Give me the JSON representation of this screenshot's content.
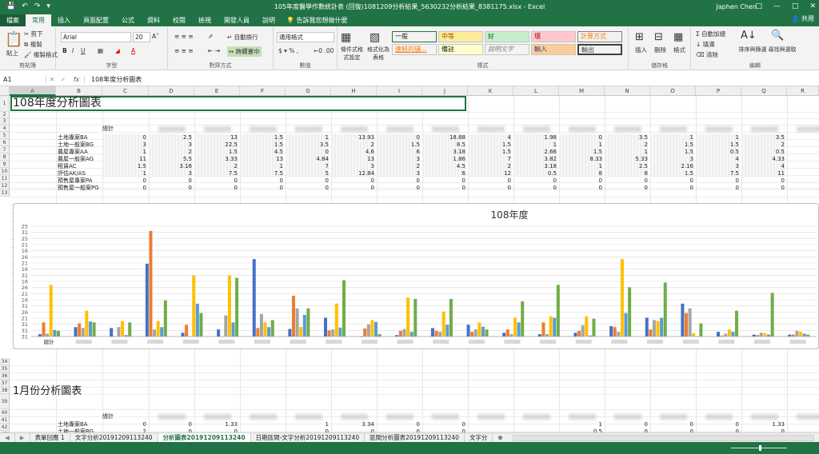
{
  "window": {
    "title": "105年度醫學作數統計表 (回復)1081209分析結果_5630232分析結果_8381175.xlsx  -  Excel",
    "user": "Japhen Chen"
  },
  "ribbon_tabs": [
    "檔案",
    "常用",
    "插入",
    "頁面配置",
    "公式",
    "資料",
    "校閱",
    "檢視",
    "開發人員",
    "說明"
  ],
  "tell_me": "告訴我您想做什麼",
  "share": "共用",
  "clipboard": {
    "paste": "貼上",
    "cut": "剪下",
    "copy": "複製",
    "format_painter": "複製格式",
    "label": "剪貼簿"
  },
  "font": {
    "name": "Arial",
    "size": "20",
    "label": "字型"
  },
  "alignment": {
    "wrap": "自動換行",
    "merge": "跨欄置中",
    "label": "對齊方式"
  },
  "number": {
    "format": "通用格式",
    "label": "數值"
  },
  "styles": {
    "conditional": "條件式格式設定",
    "as_table": "格式化為表格",
    "items": [
      {
        "label": "一般",
        "bg": "#ffffff",
        "fg": "#000000"
      },
      {
        "label": "中等",
        "bg": "#ffeb9c",
        "fg": "#9c5700"
      },
      {
        "label": "好",
        "bg": "#c6efce",
        "fg": "#006100"
      },
      {
        "label": "壞",
        "bg": "#ffc7ce",
        "fg": "#9c0006"
      },
      {
        "label": "計算方式",
        "bg": "#f2f2f2",
        "fg": "#fa7d00"
      },
      {
        "label": "連結的儲...",
        "bg": "#ffffff",
        "fg": "#fa7d00"
      },
      {
        "label": "備註",
        "bg": "#ffffcc",
        "fg": "#000000"
      },
      {
        "label": "說明文字",
        "bg": "#ffffff",
        "fg": "#7f7f7f"
      },
      {
        "label": "輸入",
        "bg": "#ffcc99",
        "fg": "#3f3f76"
      },
      {
        "label": "輸出",
        "bg": "#f2f2f2",
        "fg": "#3f3f3f"
      }
    ],
    "label": "樣式"
  },
  "cells_group": {
    "insert": "插入",
    "delete": "刪除",
    "format": "格式",
    "label": "儲存格"
  },
  "editing": {
    "autosum": "自動加總",
    "fill": "填滿",
    "clear": "清除",
    "sort": "排序與篩選",
    "find": "尋找與選取",
    "label": "編輯"
  },
  "formula_bar": {
    "name_box": "A1",
    "fx": "fx",
    "content": "108年度分析圖表"
  },
  "columns": [
    "A",
    "B",
    "C",
    "D",
    "E",
    "F",
    "G",
    "H",
    "I",
    "J",
    "K",
    "L",
    "M",
    "N",
    "O",
    "P",
    "Q",
    "R"
  ],
  "rows_top": [
    "1",
    "2",
    "3",
    "4",
    "5",
    "6",
    "7",
    "8",
    "9",
    "10",
    "11",
    "12",
    "13"
  ],
  "rows_mid": [
    "34",
    "35",
    "36",
    "37",
    "38",
    "39",
    "40",
    "41",
    "42",
    "43",
    "44"
  ],
  "sheet_title": "108年度分析圖表",
  "header_row_label": "總計",
  "row_labels": [
    "土地專案BA",
    "土地一般案BG",
    "農屋專案AA",
    "農屋一般案AG",
    "租賃AC",
    "評估AK/AS",
    "預售屋專案PA",
    "預售屋一般案PG"
  ],
  "table": [
    [
      "0",
      "2.5",
      "13",
      "1.5",
      "1",
      "13.93",
      "0",
      "18.88",
      "4",
      "1.98",
      "0",
      "3.5",
      "1",
      "1",
      "3.5"
    ],
    [
      "3",
      "3",
      "22.5",
      "1.5",
      "3.5",
      "2",
      "1.5",
      "8.5",
      "1.5",
      "1",
      "1",
      "2",
      "1.5",
      "1.5",
      "2"
    ],
    [
      "1",
      "2",
      "1.5",
      "4.5",
      "0",
      "4.6",
      "6",
      "3.18",
      "1.5",
      "2.66",
      "1.5",
      "1",
      "1.5",
      "0.5",
      "0.5"
    ],
    [
      "11",
      "5.5",
      "3.33",
      "13",
      "4.84",
      "13",
      "3",
      "1.86",
      "7",
      "3.82",
      "8.33",
      "5.33",
      "3",
      "4",
      "4.33"
    ],
    [
      "1.5",
      "3.16",
      "2",
      "1",
      "7",
      "3",
      "2",
      "4.5",
      "2",
      "3.18",
      "1",
      "2.5",
      "2.16",
      "3",
      "4"
    ],
    [
      "1",
      "3",
      "7.5",
      "7.5",
      "5",
      "12.84",
      "3",
      "6",
      "12",
      "0.5",
      "8",
      "8",
      "1.5",
      "7.5",
      "11"
    ],
    [
      "0",
      "0",
      "0",
      "0",
      "0",
      "0",
      "0",
      "0",
      "0",
      "0",
      "0",
      "0",
      "0",
      "0",
      "0"
    ],
    [
      "0",
      "0",
      "0",
      "0",
      "0",
      "0",
      "0",
      "0",
      "0",
      "0",
      "0",
      "0",
      "0",
      "0",
      "0"
    ]
  ],
  "section2_title": "1月份分析圖表",
  "section2_rows": [
    {
      "label": "土地專案BA",
      "values": [
        "0",
        "0",
        "1.33",
        "",
        "1",
        "3.34",
        "0",
        "0",
        "",
        "",
        "1",
        "0",
        "0",
        "0",
        "1.33"
      ]
    },
    {
      "label": "土地一般案BG",
      "values": [
        "2",
        "0",
        "0",
        "",
        "0",
        "0",
        "0",
        "0",
        "",
        "",
        "0.5",
        "0",
        "0",
        "0",
        "0"
      ]
    }
  ],
  "chart_data": {
    "type": "bar",
    "title": "108年度",
    "yticks": [
      "31",
      "31",
      "31",
      "21",
      "26",
      "31",
      "16",
      "21",
      "26",
      "16",
      "31",
      "16",
      "21",
      "26",
      "16",
      "21",
      "25",
      "31",
      "25"
    ],
    "x_first_label": "總計",
    "colors": [
      "#4472c4",
      "#ed7d31",
      "#a5a5a5",
      "#ffc000",
      "#5b9bd5",
      "#70ad47"
    ],
    "groups": 22,
    "series": [
      {
        "values": [
          0.5,
          2,
          1.8,
          15.5,
          0.8,
          1.5,
          16.5,
          1.6,
          4,
          0,
          0.3,
          1.8,
          2.5,
          0.8,
          0.5,
          0.8,
          2.2,
          4,
          7,
          1,
          0.4,
          0.4
        ]
      },
      {
        "values": [
          3,
          2.8,
          0,
          22.5,
          2.5,
          0,
          1.8,
          8.7,
          1.3,
          1.7,
          1.2,
          1.2,
          1,
          1.5,
          3,
          1.2,
          2,
          1.5,
          5,
          0.2,
          0.3,
          0.4
        ]
      },
      {
        "values": [
          0.6,
          1.8,
          2,
          1.5,
          0,
          4.5,
          4.8,
          6,
          1.5,
          2.6,
          1.6,
          1,
          1.5,
          0.5,
          0.5,
          2.4,
          1,
          3.5,
          6,
          0.6,
          0.8,
          1.2
        ]
      },
      {
        "values": [
          11,
          5.5,
          3.3,
          3.3,
          13,
          13,
          3,
          2,
          7,
          3.5,
          8.3,
          5.3,
          3,
          4,
          4.3,
          4.3,
          16.5,
          3.3,
          0.7,
          1.5,
          0.7,
          1
        ]
      },
      {
        "values": [
          1.4,
          3.2,
          0.3,
          2,
          7,
          3,
          2,
          4.6,
          1.9,
          3.1,
          1,
          2.5,
          2.1,
          3,
          4,
          0.2,
          5,
          4,
          0,
          1,
          0.4,
          0.6
        ]
      },
      {
        "values": [
          1.2,
          3,
          3,
          7.7,
          5,
          12.5,
          3.5,
          6,
          12,
          0.5,
          8,
          8,
          1.5,
          7.5,
          11,
          3.8,
          10.5,
          11.5,
          2.8,
          5.5,
          9.3,
          0.4
        ]
      }
    ]
  },
  "sheet_tabs": [
    "表單回應 1",
    "文字分析20191209113240",
    "分析圖表20191209113240",
    "日期區間-文字分析20191209113240",
    "區間分析圖表20191209113240",
    "文字分"
  ],
  "colors": {
    "excel_green": "#217346",
    "accent": "#217346"
  }
}
